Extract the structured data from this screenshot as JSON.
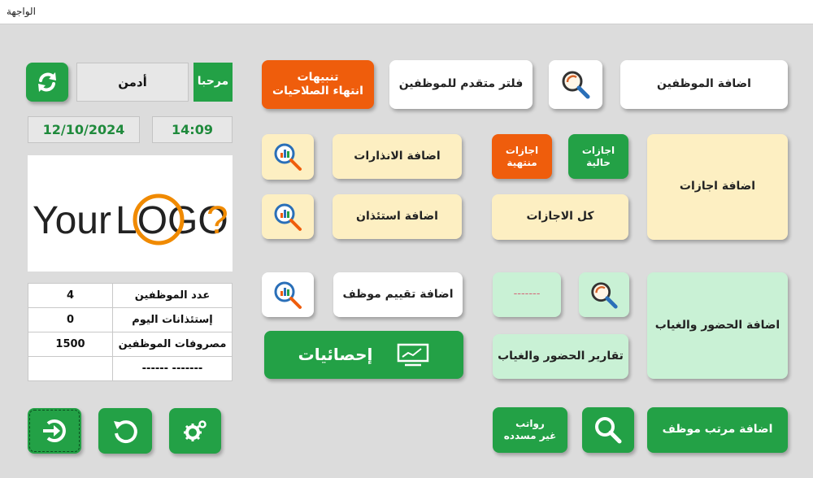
{
  "window": {
    "title": "الواجهة"
  },
  "header": {
    "welcome": "مرحبا",
    "user": "أدمن",
    "date": "12/10/2024",
    "time": "14:09"
  },
  "logo": {
    "text_dark": "Your",
    "text_accent": "LOGO",
    "mark": "?"
  },
  "stats": {
    "rows": [
      {
        "label": "عدد الموظفين",
        "value": "4"
      },
      {
        "label": "إستئذانات اليوم",
        "value": "0"
      },
      {
        "label": "مصروفات الموظفين",
        "value": "1500"
      },
      {
        "label": "------ -------",
        "value": ""
      }
    ]
  },
  "buttons": {
    "alerts_line1": "تنبيهات",
    "alerts_line2": "انتهاء الصلاحيات",
    "advanced_filter": "فلتر متقدم للموظفين",
    "add_employees": "اضافة الموظفين",
    "add_warnings": "اضافة الانذارات",
    "add_permission": "اضافة استئذان",
    "ended_leaves_line1": "اجازات",
    "ended_leaves_line2": "منتهية",
    "current_leaves_line1": "اجازات",
    "current_leaves_line2": "حالية",
    "add_leaves": "اضافة اجازات",
    "all_leaves": "كل الاجازات",
    "add_evaluation": "اضافة تقييم موظف",
    "statistics": "إحصائيات",
    "attendance_placeholder": "-------",
    "add_attendance": "اضافة الحضور والغياب",
    "attendance_reports": "تقارير الحضور والغياب",
    "unpaid_salaries_line1": "رواتب",
    "unpaid_salaries_line2": "غير مسدده",
    "add_salary": "اضافة مرتب موظف"
  },
  "colors": {
    "green": "#23a146",
    "orange": "#ef5d0c",
    "cream": "#fdefc2",
    "mint": "#c9f1d5"
  }
}
